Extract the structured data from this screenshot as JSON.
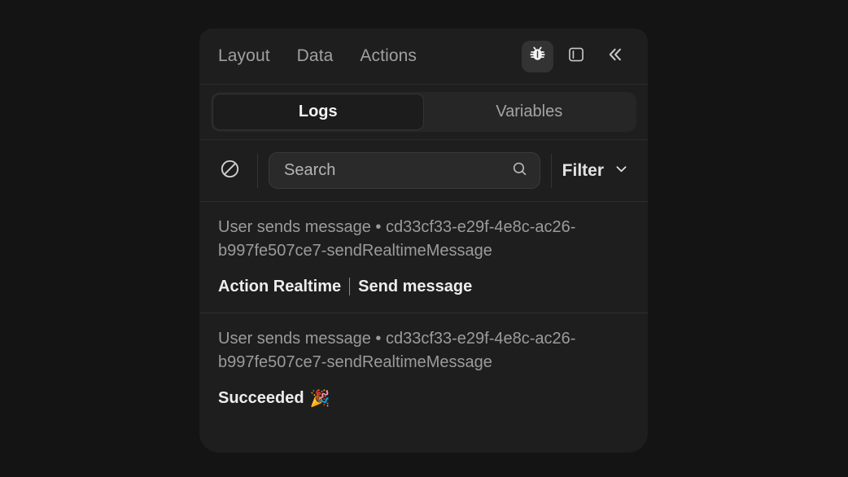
{
  "header": {
    "nav": [
      {
        "label": "Layout",
        "name": "nav-item-layout"
      },
      {
        "label": "Data",
        "name": "nav-item-data"
      },
      {
        "label": "Actions",
        "name": "nav-item-actions"
      }
    ],
    "icons": [
      {
        "name": "bug-icon",
        "label": "Debug",
        "active": true
      },
      {
        "name": "panel-left-icon",
        "label": "Toggle panel",
        "active": false
      },
      {
        "name": "chevrons-left-icon",
        "label": "Collapse",
        "active": false
      }
    ]
  },
  "tabs": {
    "items": [
      {
        "label": "Logs",
        "active": true
      },
      {
        "label": "Variables",
        "active": false
      }
    ]
  },
  "toolbar": {
    "clear_icon": "ban-icon",
    "search": {
      "value": "",
      "placeholder": "Search",
      "icon": "search-icon"
    },
    "filter": {
      "label": "Filter",
      "icon": "chevron-down-icon"
    }
  },
  "logs": [
    {
      "meta": "User sends message • cd33cf33-e29f-4e8c-ac26-b997fe507ce7-sendRealtimeMessage",
      "body_left": "Action Realtime",
      "body_right": "Send message",
      "emoji": ""
    },
    {
      "meta": "User sends message • cd33cf33-e29f-4e8c-ac26-b997fe507ce7-sendRealtimeMessage",
      "body_left": "Succeeded",
      "body_right": "",
      "emoji": "🎉"
    }
  ],
  "colors": {
    "app_background": "#141414",
    "panel_background": "#1e1e1e",
    "divider": "#2b2b2b",
    "muted_text": "#9b9b9b",
    "primary_text": "#ededed",
    "input_background": "#2a2a2a",
    "active_tab_background": "#1c1c1c"
  }
}
